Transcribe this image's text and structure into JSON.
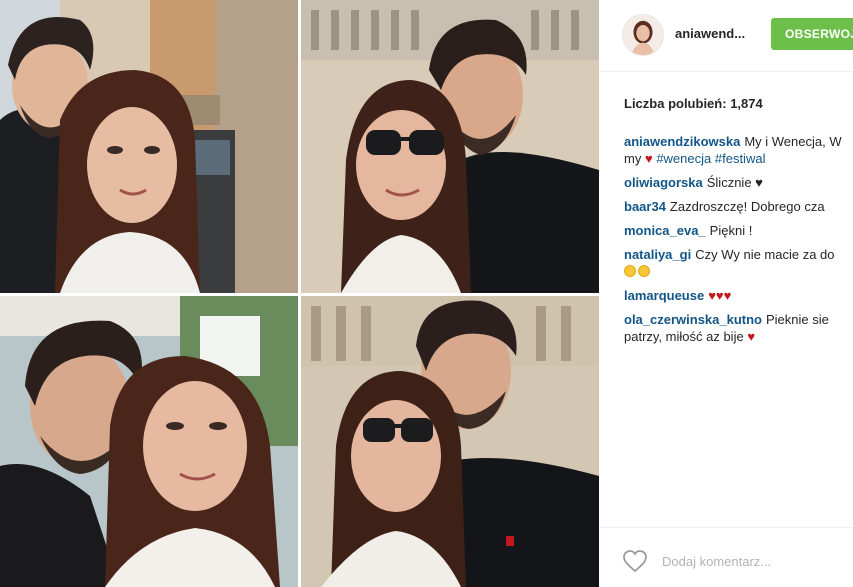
{
  "post": {
    "username": "aniawend...",
    "follow_label": "OBSERWOJ",
    "likes_label": "Liczba polubień:",
    "likes_count": "1,874",
    "comments": [
      {
        "user": "aniawendzikowska",
        "text": "My i Wenecja, W",
        "line2": "my",
        "tags": [
          "#wenecja",
          "#festiwal"
        ]
      },
      {
        "user": "oliwiagorska",
        "text": "Ślicznie ♥"
      },
      {
        "user": "baar34",
        "text": "Zazdroszczę! Dobrego cza"
      },
      {
        "user": "monica_eva_",
        "text": "Piękni !"
      },
      {
        "user": "nataliya_gi",
        "text": "Czy Wy nie macie za do"
      },
      {
        "user": "lamarqueuse",
        "text": ""
      },
      {
        "user": "ola_czerwinska_kutno",
        "text": "Pieknie sie",
        "line2": "patrzy, miłość az bije"
      }
    ],
    "comment_placeholder": "Dodaj komentarz..."
  },
  "colors": {
    "follow": "#6cc04a",
    "link": "#125688",
    "heart": "#c3181e"
  },
  "icons": {
    "like": "heart-outline-icon"
  }
}
